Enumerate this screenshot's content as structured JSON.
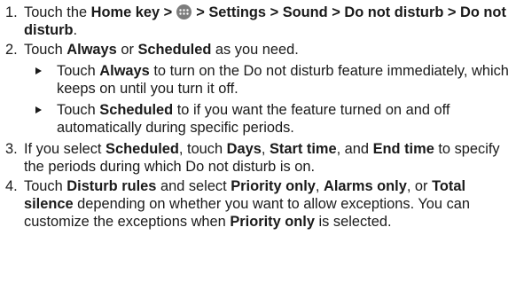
{
  "steps": [
    {
      "number": "1.",
      "parts": [
        {
          "t": "Touch the "
        },
        {
          "b": "Home"
        },
        {
          "t": " "
        },
        {
          "b": "key >"
        },
        {
          "icon": "apps-icon"
        },
        {
          "b": "> Settings > Sound > Do not disturb > Do not disturb"
        },
        {
          "t": "."
        }
      ]
    },
    {
      "number": "2.",
      "parts": [
        {
          "t": "Touch "
        },
        {
          "b": "Always"
        },
        {
          "t": " or "
        },
        {
          "b": "Scheduled"
        },
        {
          "t": " as you need."
        }
      ],
      "subs": [
        [
          {
            "t": "Touch "
          },
          {
            "b": "Always"
          },
          {
            "t": " to turn on the Do not disturb feature immediately, which keeps on until you turn it off."
          }
        ],
        [
          {
            "t": "Touch "
          },
          {
            "b": "Scheduled"
          },
          {
            "t": " to if you want the feature turned on and off automatically during specific periods."
          }
        ]
      ]
    },
    {
      "number": "3.",
      "parts": [
        {
          "t": "If you select "
        },
        {
          "b": "Scheduled"
        },
        {
          "t": ", touch "
        },
        {
          "b": "Days"
        },
        {
          "t": ", "
        },
        {
          "b": "Start time"
        },
        {
          "t": ", and "
        },
        {
          "b": "End time"
        },
        {
          "t": " to specify the periods during which Do not disturb is on."
        }
      ]
    },
    {
      "number": "4.",
      "parts": [
        {
          "t": "Touch "
        },
        {
          "b": "Disturb rules"
        },
        {
          "t": " and select "
        },
        {
          "b": "Priority only"
        },
        {
          "t": ", "
        },
        {
          "b": "Alarms only"
        },
        {
          "t": ", or "
        },
        {
          "b": "Total silence"
        },
        {
          "t": " depending on whether you want to allow exceptions. You can customize the exceptions when "
        },
        {
          "b": "Priority only"
        },
        {
          "t": " is selected."
        }
      ]
    }
  ],
  "colors": {
    "text": "#1a1a1a",
    "icon_fill": "#7d7d7d",
    "icon_dots": "#ffffff"
  }
}
